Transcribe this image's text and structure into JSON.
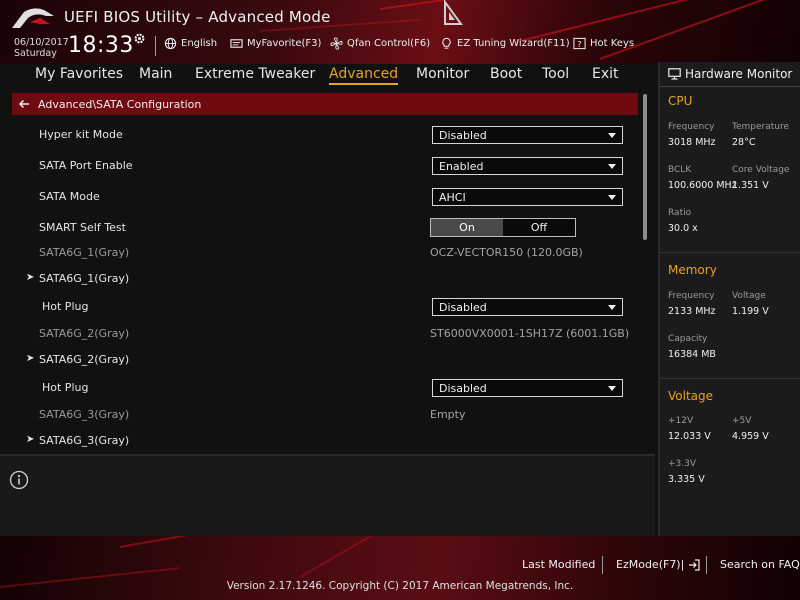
{
  "header": {
    "title": "UEFI BIOS Utility – Advanced Mode",
    "date": "06/10/2017",
    "day": "Saturday",
    "time": "18:33",
    "tools": [
      {
        "label": "English",
        "icon": "globe-icon"
      },
      {
        "label": "MyFavorite(F3)",
        "icon": "favorite-icon"
      },
      {
        "label": "Qfan Control(F6)",
        "icon": "fan-icon"
      },
      {
        "label": "EZ Tuning Wizard(F11)",
        "icon": "bulb-icon"
      },
      {
        "label": "Hot Keys",
        "icon": "question-icon"
      }
    ]
  },
  "nav": {
    "tabs": [
      "My Favorites",
      "Main",
      "Extreme Tweaker",
      "Advanced",
      "Monitor",
      "Boot",
      "Tool",
      "Exit"
    ],
    "active": "Advanced"
  },
  "breadcrumb": "Advanced\\SATA Configuration",
  "settings": {
    "hyper_kit": {
      "label": "Hyper kit Mode",
      "value": "Disabled"
    },
    "sata_port_enable": {
      "label": "SATA Port Enable",
      "value": "Enabled"
    },
    "sata_mode": {
      "label": "SATA Mode",
      "value": "AHCI"
    },
    "smart_self_test": {
      "label": "SMART Self Test",
      "on": "On",
      "off": "Off",
      "selected": "On"
    },
    "port1": {
      "label": "SATA6G_1(Gray)",
      "device": "OCZ-VECTOR150 (120.0GB)",
      "expander": "SATA6G_1(Gray)",
      "hotplug_label": "Hot Plug",
      "hotplug": "Disabled"
    },
    "port2": {
      "label": "SATA6G_2(Gray)",
      "device": "ST6000VX0001-1SH17Z (6001.1GB)",
      "expander": "SATA6G_2(Gray)",
      "hotplug_label": "Hot Plug",
      "hotplug": "Disabled"
    },
    "port3": {
      "label": "SATA6G_3(Gray)",
      "device": "Empty",
      "expander": "SATA6G_3(Gray)"
    }
  },
  "hw_monitor": {
    "title": "Hardware Monitor",
    "cpu": {
      "heading": "CPU",
      "frequency_label": "Frequency",
      "frequency": "3018 MHz",
      "temperature_label": "Temperature",
      "temperature": "28°C",
      "bclk_label": "BCLK",
      "bclk": "100.6000 MHz",
      "core_voltage_label": "Core Voltage",
      "core_voltage": "1.351 V",
      "ratio_label": "Ratio",
      "ratio": "30.0 x"
    },
    "memory": {
      "heading": "Memory",
      "frequency_label": "Frequency",
      "frequency": "2133 MHz",
      "voltage_label": "Voltage",
      "voltage": "1.199 V",
      "capacity_label": "Capacity",
      "capacity": "16384 MB"
    },
    "voltage": {
      "heading": "Voltage",
      "v12_label": "+12V",
      "v12": "12.033 V",
      "v5_label": "+5V",
      "v5": "4.959 V",
      "v33_label": "+3.3V",
      "v33": "3.335 V"
    }
  },
  "footer": {
    "last_modified": "Last Modified",
    "ezmode": "EzMode(F7)|",
    "search": "Search on FAQ",
    "version": "Version 2.17.1246. Copyright (C) 2017 American Megatrends, Inc."
  },
  "colors": {
    "accent": "#e8a321",
    "brand_red": "#6e0a10"
  }
}
